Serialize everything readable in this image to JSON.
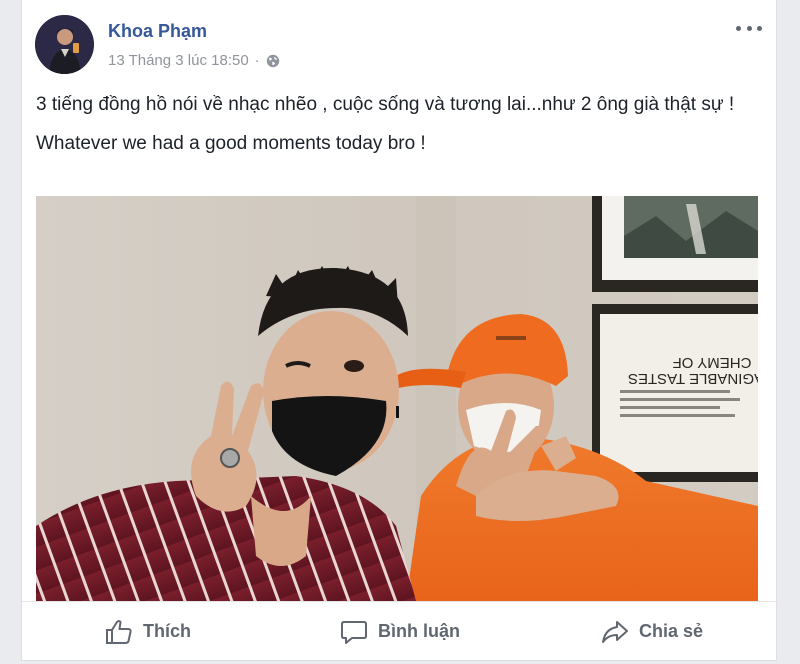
{
  "post": {
    "author": "Khoa Phạm",
    "timestamp": "13 Tháng 3 lúc 18:50",
    "separator": "·",
    "privacy_icon": "globe-icon",
    "more_icon": "more-options-icon",
    "text_lines": [
      "3 tiếng đồng hồ nói về nhạc nhẽo , cuộc sống và tương lai...như 2 ông già thật sự !",
      "Whatever we had a good moments today bro !"
    ],
    "photo": {
      "poster_lines": [
        "CHEMY OF",
        "AGINABLE TASTES"
      ]
    }
  },
  "actions": {
    "like": {
      "label": "Thích",
      "icon": "thumbs-up-icon"
    },
    "comment": {
      "label": "Bình luận",
      "icon": "comment-icon"
    },
    "share": {
      "label": "Chia sẻ",
      "icon": "share-icon"
    }
  },
  "colors": {
    "author": "#365899",
    "meta": "#90949c",
    "text": "#1d2129",
    "action": "#616770",
    "background": "#e9ebee"
  }
}
